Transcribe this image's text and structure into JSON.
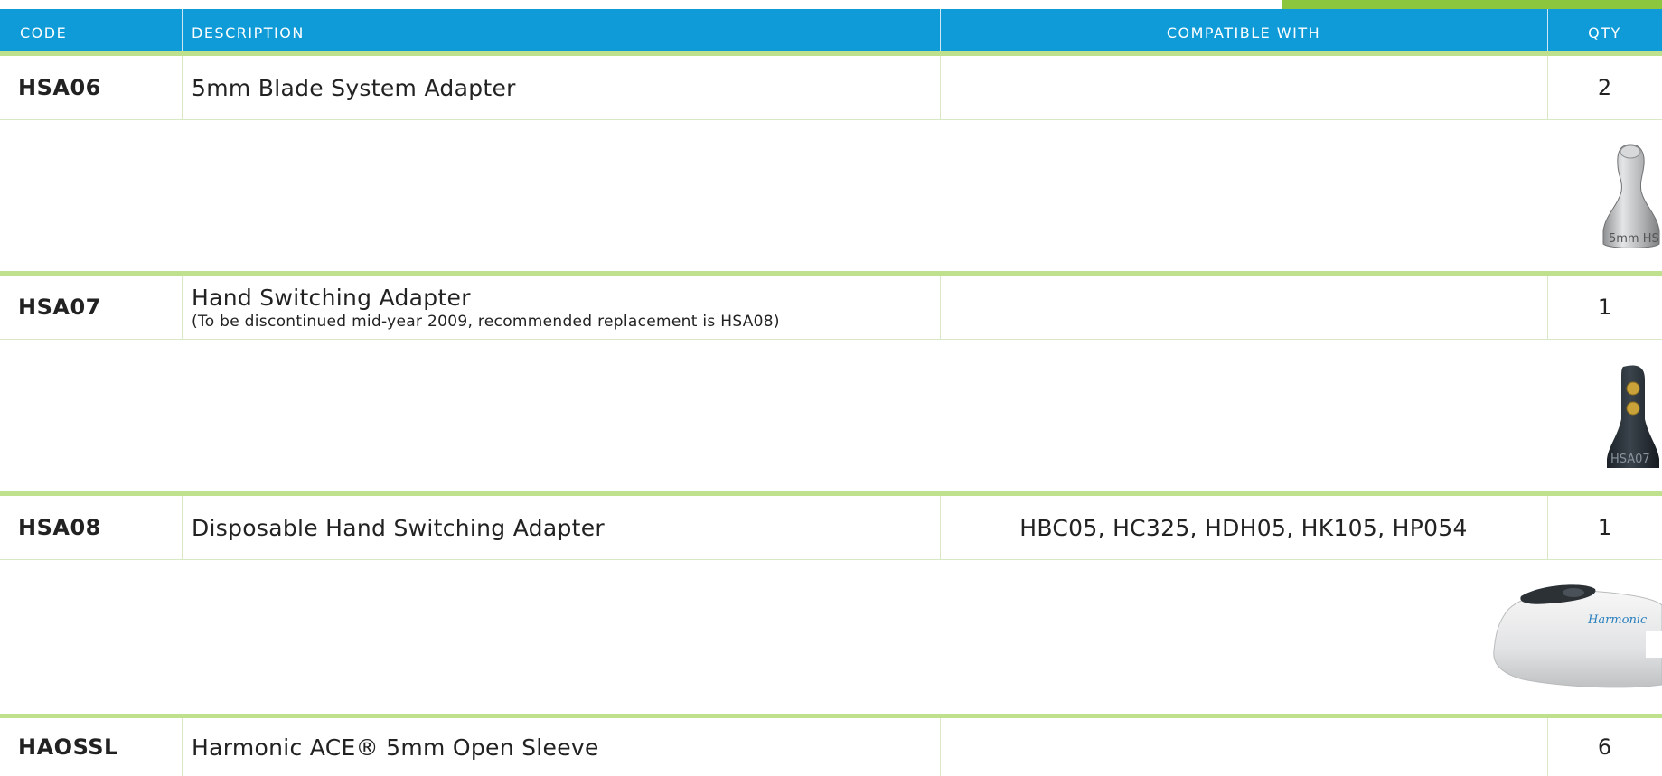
{
  "table": {
    "headers": {
      "code": "CODE",
      "description": "DESCRIPTION",
      "compatible": "COMPATIBLE WITH",
      "qty": "QTY"
    },
    "rows": [
      {
        "code": "HSA06",
        "description": "5mm Blade System Adapter",
        "note": "",
        "compatible": "",
        "qty": "2"
      },
      {
        "code": "HSA07",
        "description": "Hand Switching Adapter",
        "note": "(To be discontinued mid-year 2009, recommended replacement is HSA08)",
        "compatible": "",
        "qty": "1"
      },
      {
        "code": "HSA08",
        "description": "Disposable Hand Switching Adapter",
        "note": "",
        "compatible": "HBC05, HC325, HDH05, HK105, HP054",
        "qty": "1"
      },
      {
        "code": "HAOSSL",
        "description": "Harmonic ACE® 5mm Open Sleeve",
        "note": "",
        "compatible": "",
        "qty": "6"
      }
    ],
    "product_images": [
      {
        "icon": "blade-adapter-image",
        "label": "5mm HS"
      },
      {
        "icon": "hand-switch-adapter-image",
        "label": "HSA07"
      },
      {
        "icon": "disposable-adapter-image",
        "label": "Harmonic"
      }
    ]
  },
  "colors": {
    "header_blue": "#0f9bd7",
    "accent_green": "#8cc63f",
    "row_divider_green": "#bfe08d"
  }
}
